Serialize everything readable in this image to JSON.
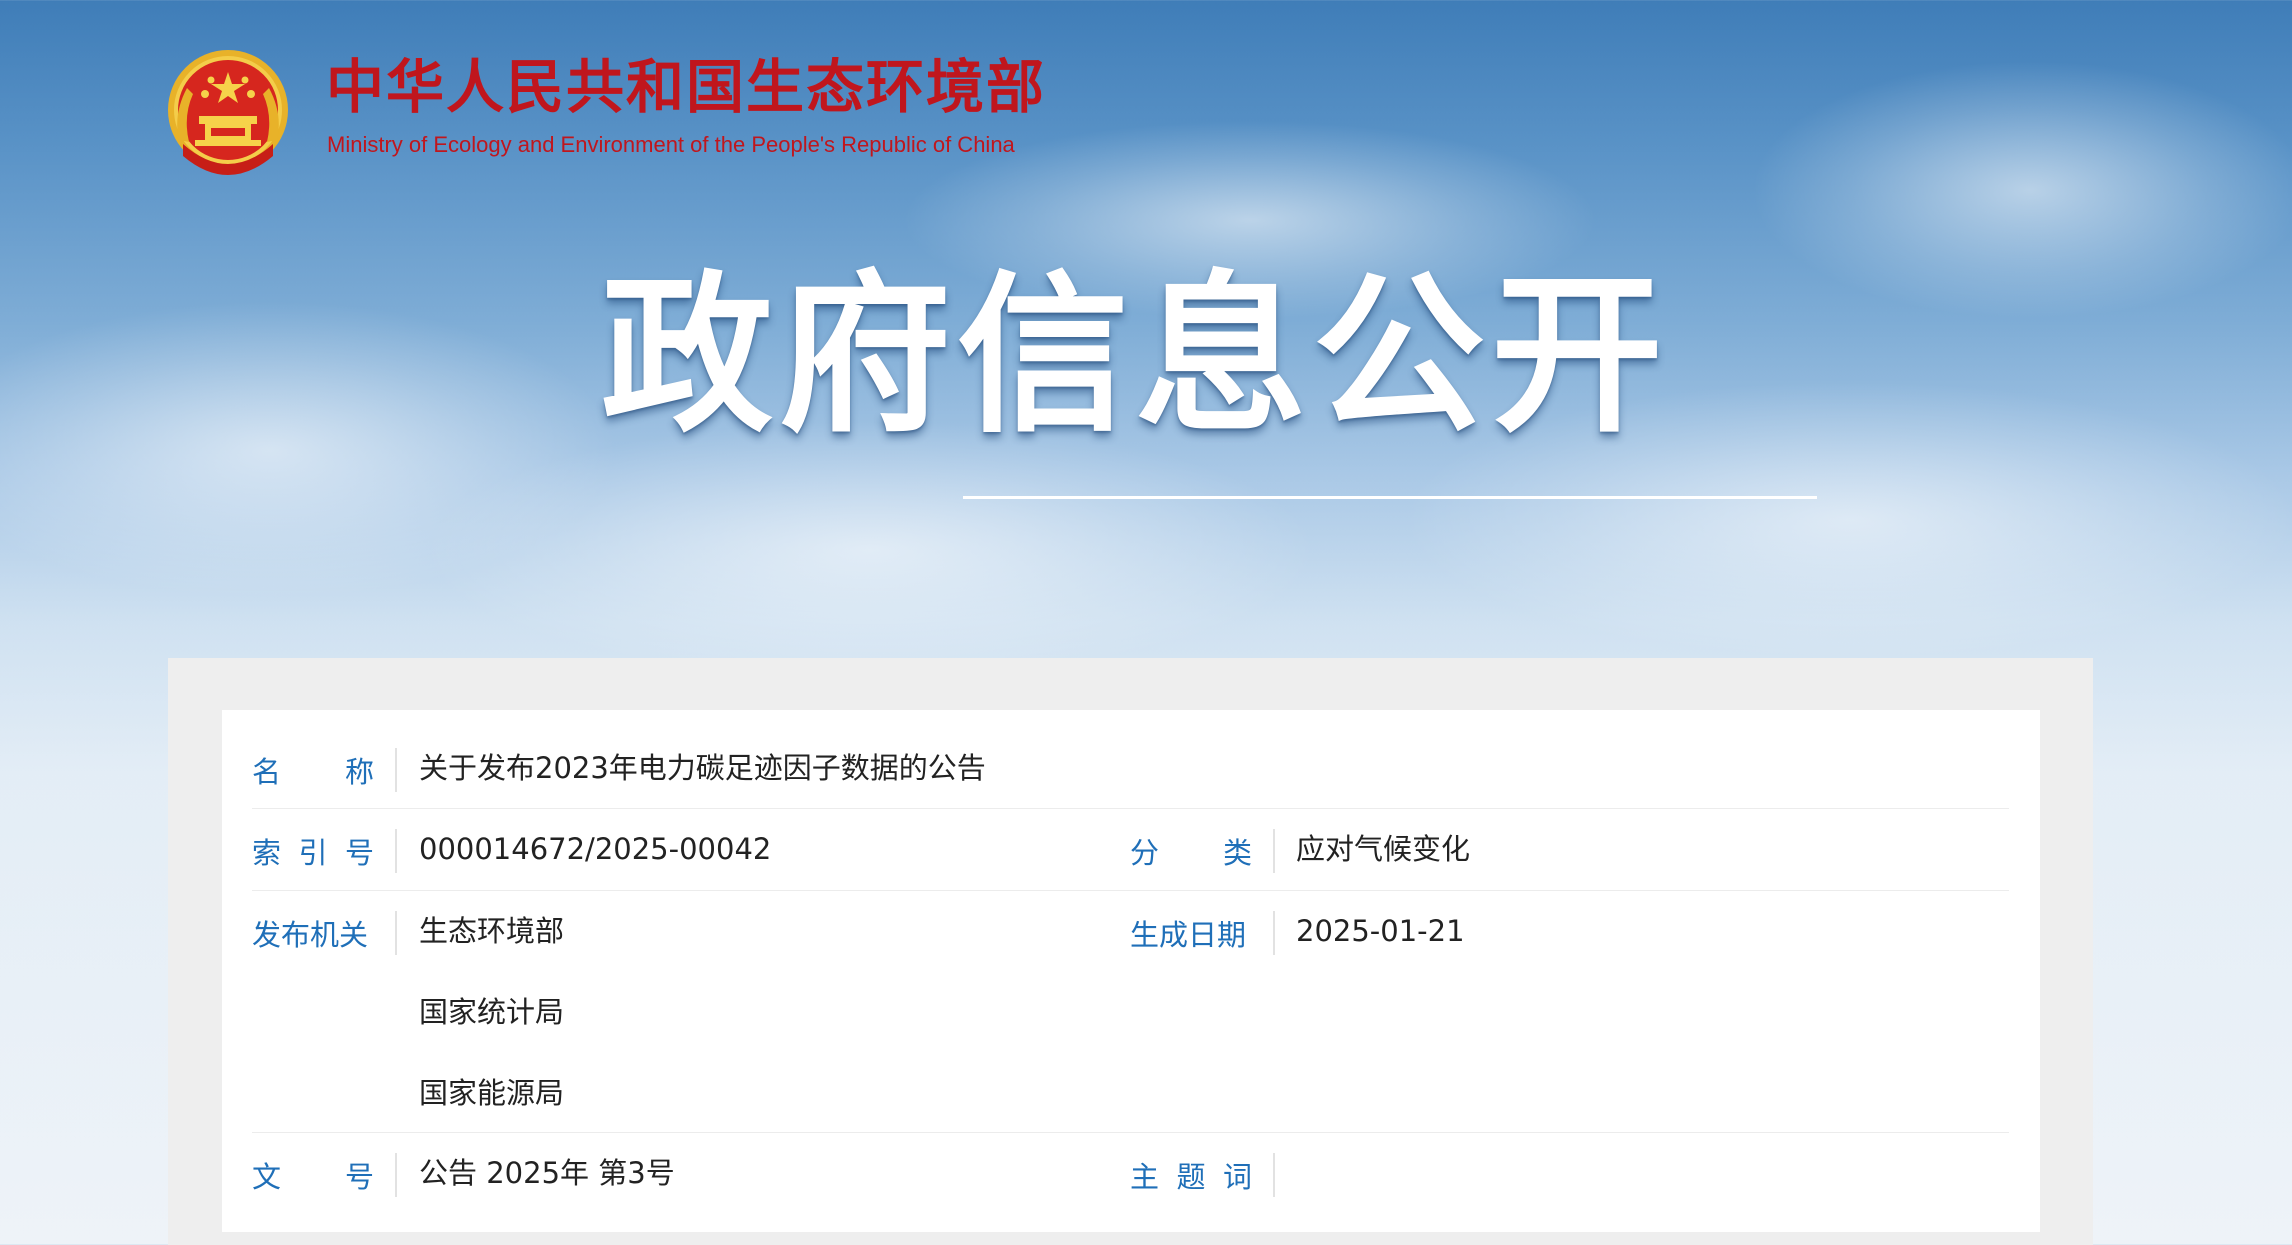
{
  "header": {
    "ministry_cn": "中华人民共和国生态环境部",
    "ministry_en": "Ministry of Ecology and Environment of the People's Republic of China",
    "emblem_icon": "national-emblem-icon"
  },
  "hero": {
    "title": "政府信息公开"
  },
  "info": {
    "name": {
      "label_chars": [
        "名",
        "称"
      ],
      "value": "关于发布2023年电力碳足迹因子数据的公告"
    },
    "index_no": {
      "label_chars": [
        "索",
        "引",
        "号"
      ],
      "value": "000014672/2025-00042"
    },
    "category": {
      "label_chars": [
        "分",
        "类"
      ],
      "value": "应对气候变化"
    },
    "issuer": {
      "label": "发布机关",
      "values": [
        "生态环境部",
        "国家统计局",
        "国家能源局"
      ]
    },
    "date": {
      "label": "生成日期",
      "value": "2025-01-21"
    },
    "doc_no": {
      "label_chars": [
        "文",
        "号"
      ],
      "value": "公告 2025年 第3号"
    },
    "keywords": {
      "label_chars": [
        "主",
        "题",
        "词"
      ],
      "value": ""
    }
  },
  "colors": {
    "brand_red": "#c0161d",
    "label_blue": "#1f6fb8",
    "text": "#222222"
  }
}
